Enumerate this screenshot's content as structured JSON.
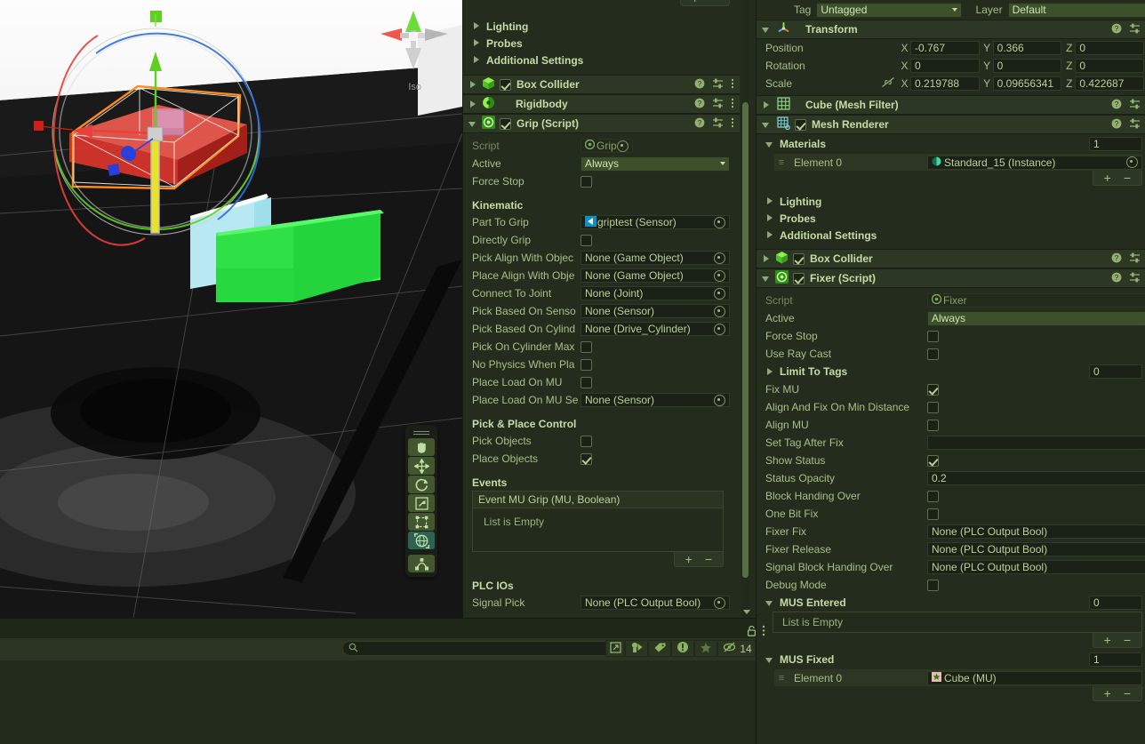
{
  "scene": {
    "gizmo_label": "Iso",
    "tools": [
      {
        "name": "hand-tool",
        "selected": false
      },
      {
        "name": "move-tool",
        "selected": false
      },
      {
        "name": "rotate-tool",
        "selected": false
      },
      {
        "name": "scale-tool",
        "selected": false
      },
      {
        "name": "rect-tool",
        "selected": false
      },
      {
        "name": "transform-tool",
        "selected": true
      },
      {
        "name": "custom-tool",
        "selected": false
      }
    ],
    "objects": [
      {
        "name": "selected-red-box",
        "color": "#e03a34"
      },
      {
        "name": "cyan-box",
        "color": "#c9f1f7"
      },
      {
        "name": "green-box",
        "color": "#2ff24a"
      }
    ],
    "axis_colors": {
      "x": "#e8403a",
      "y": "#5ed11e",
      "z": "#2f6fe0"
    },
    "selection_outline": "#ff8c1a"
  },
  "inspector_a": {
    "collapsed_sections": [
      "Lighting",
      "Probes",
      "Additional Settings"
    ],
    "components": [
      {
        "name": "Box Collider",
        "enabled": true,
        "icon": "box-collider-icon",
        "expanded": false
      },
      {
        "name": "Rigidbody",
        "enabled": null,
        "icon": "rigidbody-icon",
        "expanded": false
      },
      {
        "name": "Grip (Script)",
        "enabled": true,
        "icon": "script-icon",
        "expanded": true
      }
    ],
    "grip": {
      "script_label": "Script",
      "script_value": "Grip",
      "active_label": "Active",
      "active_value": "Always",
      "force_stop_label": "Force Stop",
      "force_stop_checked": false,
      "kinematic_header": "Kinematic",
      "fields": [
        {
          "label": "Part To Grip",
          "value": "griptest (Sensor)",
          "type": "object",
          "icon": "sensor-icon"
        },
        {
          "label": "Directly Grip",
          "value": false,
          "type": "checkbox"
        },
        {
          "label": "Pick Align With Objec",
          "value": "None (Game Object)",
          "type": "object"
        },
        {
          "label": "Place Align With Obje",
          "value": "None (Game Object)",
          "type": "object"
        },
        {
          "label": "Connect To Joint",
          "value": "None (Joint)",
          "type": "object"
        },
        {
          "label": "Pick Based On Senso",
          "value": "None (Sensor)",
          "type": "object"
        },
        {
          "label": "Pick Based On Cylind",
          "value": "None (Drive_Cylinder)",
          "type": "object"
        },
        {
          "label": "Pick On Cylinder Max",
          "value": false,
          "type": "checkbox"
        },
        {
          "label": "No Physics When Pla",
          "value": false,
          "type": "checkbox"
        },
        {
          "label": "Place Load On MU",
          "value": false,
          "type": "checkbox"
        },
        {
          "label": "Place Load On MU Se",
          "value": "None (Sensor)",
          "type": "object"
        }
      ],
      "pick_place_header": "Pick & Place Control",
      "pick_place": [
        {
          "label": "Pick Objects",
          "value": false
        },
        {
          "label": "Place Objects",
          "value": true
        }
      ],
      "events_header": "Events",
      "event_name": "Event MU Grip (MU, Boolean)",
      "event_empty": "List is Empty",
      "plc_header": "PLC IOs",
      "plc_fields": [
        {
          "label": "Signal Pick",
          "value": "None (PLC Output Bool)"
        }
      ]
    },
    "add_remove": {
      "plus": "+",
      "minus": "−"
    }
  },
  "inspector_b": {
    "tag_label": "Tag",
    "tag_value": "Untagged",
    "layer_label": "Layer",
    "layer_value": "Default",
    "transform": {
      "title": "Transform",
      "rows": [
        {
          "label": "Position",
          "x": "-0.767",
          "y": "0.366",
          "z": "0"
        },
        {
          "label": "Rotation",
          "x": "0",
          "y": "0",
          "z": "0"
        },
        {
          "label": "Scale",
          "x": "0.219788",
          "y": "0.09656341",
          "z": "0.422687",
          "linked": false
        }
      ],
      "axes": [
        "X",
        "Y",
        "Z"
      ]
    },
    "mesh_filter": {
      "name": "Cube (Mesh Filter)",
      "expanded": false
    },
    "mesh_renderer": {
      "name": "Mesh Renderer",
      "enabled": true,
      "expanded": true
    },
    "materials": {
      "header": "Materials",
      "count": "1",
      "elements": [
        {
          "label": "Element 0",
          "value": "Standard_15 (Instance)"
        }
      ]
    },
    "collapsed_sections": [
      "Lighting",
      "Probes",
      "Additional Settings"
    ],
    "box_collider": {
      "name": "Box Collider",
      "enabled": true
    },
    "fixer": {
      "name": "Fixer (Script)",
      "enabled": true,
      "script_label": "Script",
      "script_value": "Fixer",
      "rows": [
        {
          "label": "Active",
          "value": "Always",
          "type": "popup"
        },
        {
          "label": "Force Stop",
          "value": false,
          "type": "checkbox"
        },
        {
          "label": "Use Ray Cast",
          "value": false,
          "type": "checkbox"
        },
        {
          "label": "Limit To Tags",
          "value": "0",
          "type": "foldout-count"
        },
        {
          "label": "Fix MU",
          "value": true,
          "type": "checkbox"
        },
        {
          "label": "Align And Fix On Min Distance",
          "value": false,
          "type": "checkbox"
        },
        {
          "label": "Align MU",
          "value": false,
          "type": "checkbox"
        },
        {
          "label": "Set Tag After Fix",
          "value": "",
          "type": "text"
        },
        {
          "label": "Show Status",
          "value": true,
          "type": "checkbox"
        },
        {
          "label": "Status Opacity",
          "value": "0.2",
          "type": "text"
        },
        {
          "label": "Block Handing Over",
          "value": false,
          "type": "checkbox"
        },
        {
          "label": "One Bit Fix",
          "value": false,
          "type": "checkbox"
        },
        {
          "label": "Fixer Fix",
          "value": "None (PLC Output Bool)",
          "type": "object"
        },
        {
          "label": "Fixer Release",
          "value": "None (PLC Output Bool)",
          "type": "object"
        },
        {
          "label": "Signal Block Handing Over",
          "value": "None (PLC Output Bool)",
          "type": "object"
        },
        {
          "label": "Debug Mode",
          "value": false,
          "type": "checkbox"
        }
      ],
      "mus_entered": {
        "header": "MUS Entered",
        "count": "0",
        "empty": "List is Empty"
      },
      "mus_fixed": {
        "header": "MUS Fixed",
        "count": "1",
        "elements": [
          {
            "label": "Element 0",
            "value": "Cube (MU)"
          }
        ]
      }
    },
    "add_remove": {
      "plus": "+",
      "minus": "−"
    }
  },
  "console": {
    "search_placeholder": "",
    "search_value": "",
    "error_count": "14",
    "toolbar_icons": [
      "collapse-icon",
      "clear-on-play-icon",
      "tag-icon",
      "error-icon",
      "star-icon",
      "mute-audio-icon"
    ],
    "lock_icon": "lock-icon",
    "menu_icon": "menu-dots-icon"
  }
}
